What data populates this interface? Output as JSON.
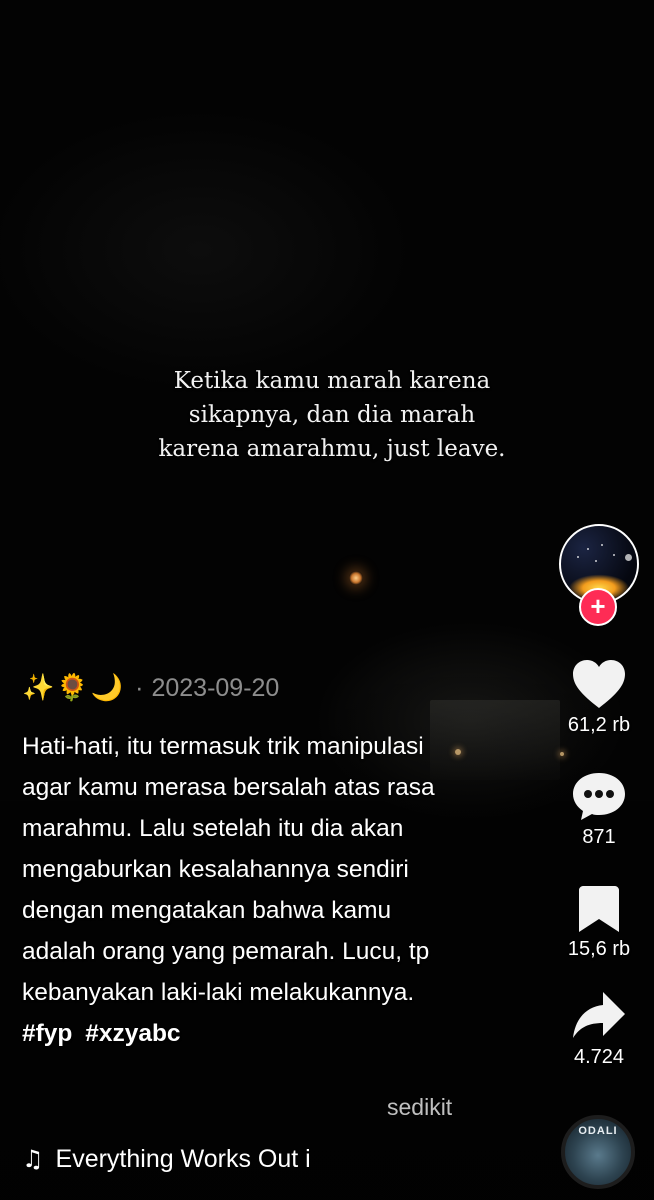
{
  "video": {
    "overlay_text": "Ketika kamu marah karena sikapnya, dan dia marah karena amarahmu, just leave."
  },
  "author": {
    "avatar_icon": "avatar-night-sky",
    "follow_symbol": "+"
  },
  "actions": {
    "like_count": "61,2 rb",
    "comment_count": "871",
    "bookmark_count": "15,6 rb",
    "share_count": "4.724"
  },
  "caption": {
    "emojis": "✨🌻🌙",
    "separator": "·",
    "date": "2023-09-20",
    "text": "Hati-hati, itu termasuk trik manipulasi agar kamu merasa bersalah atas rasa marahmu. Lalu setelah itu dia akan mengaburkan kesalahannya sendiri dengan mengatakan bahwa kamu adalah orang yang pemarah. Lucu, tp kebanyakan laki-laki melakukannya.",
    "hashtag_1": "#fyp",
    "hashtag_2": "#xzyabc",
    "see_less": "sedikit"
  },
  "music": {
    "note_icon": "♫",
    "title": "Everything Works Out i",
    "disc_label": "ODALI"
  },
  "colors": {
    "follow_accent": "#fe2c55",
    "background": "#000000"
  }
}
